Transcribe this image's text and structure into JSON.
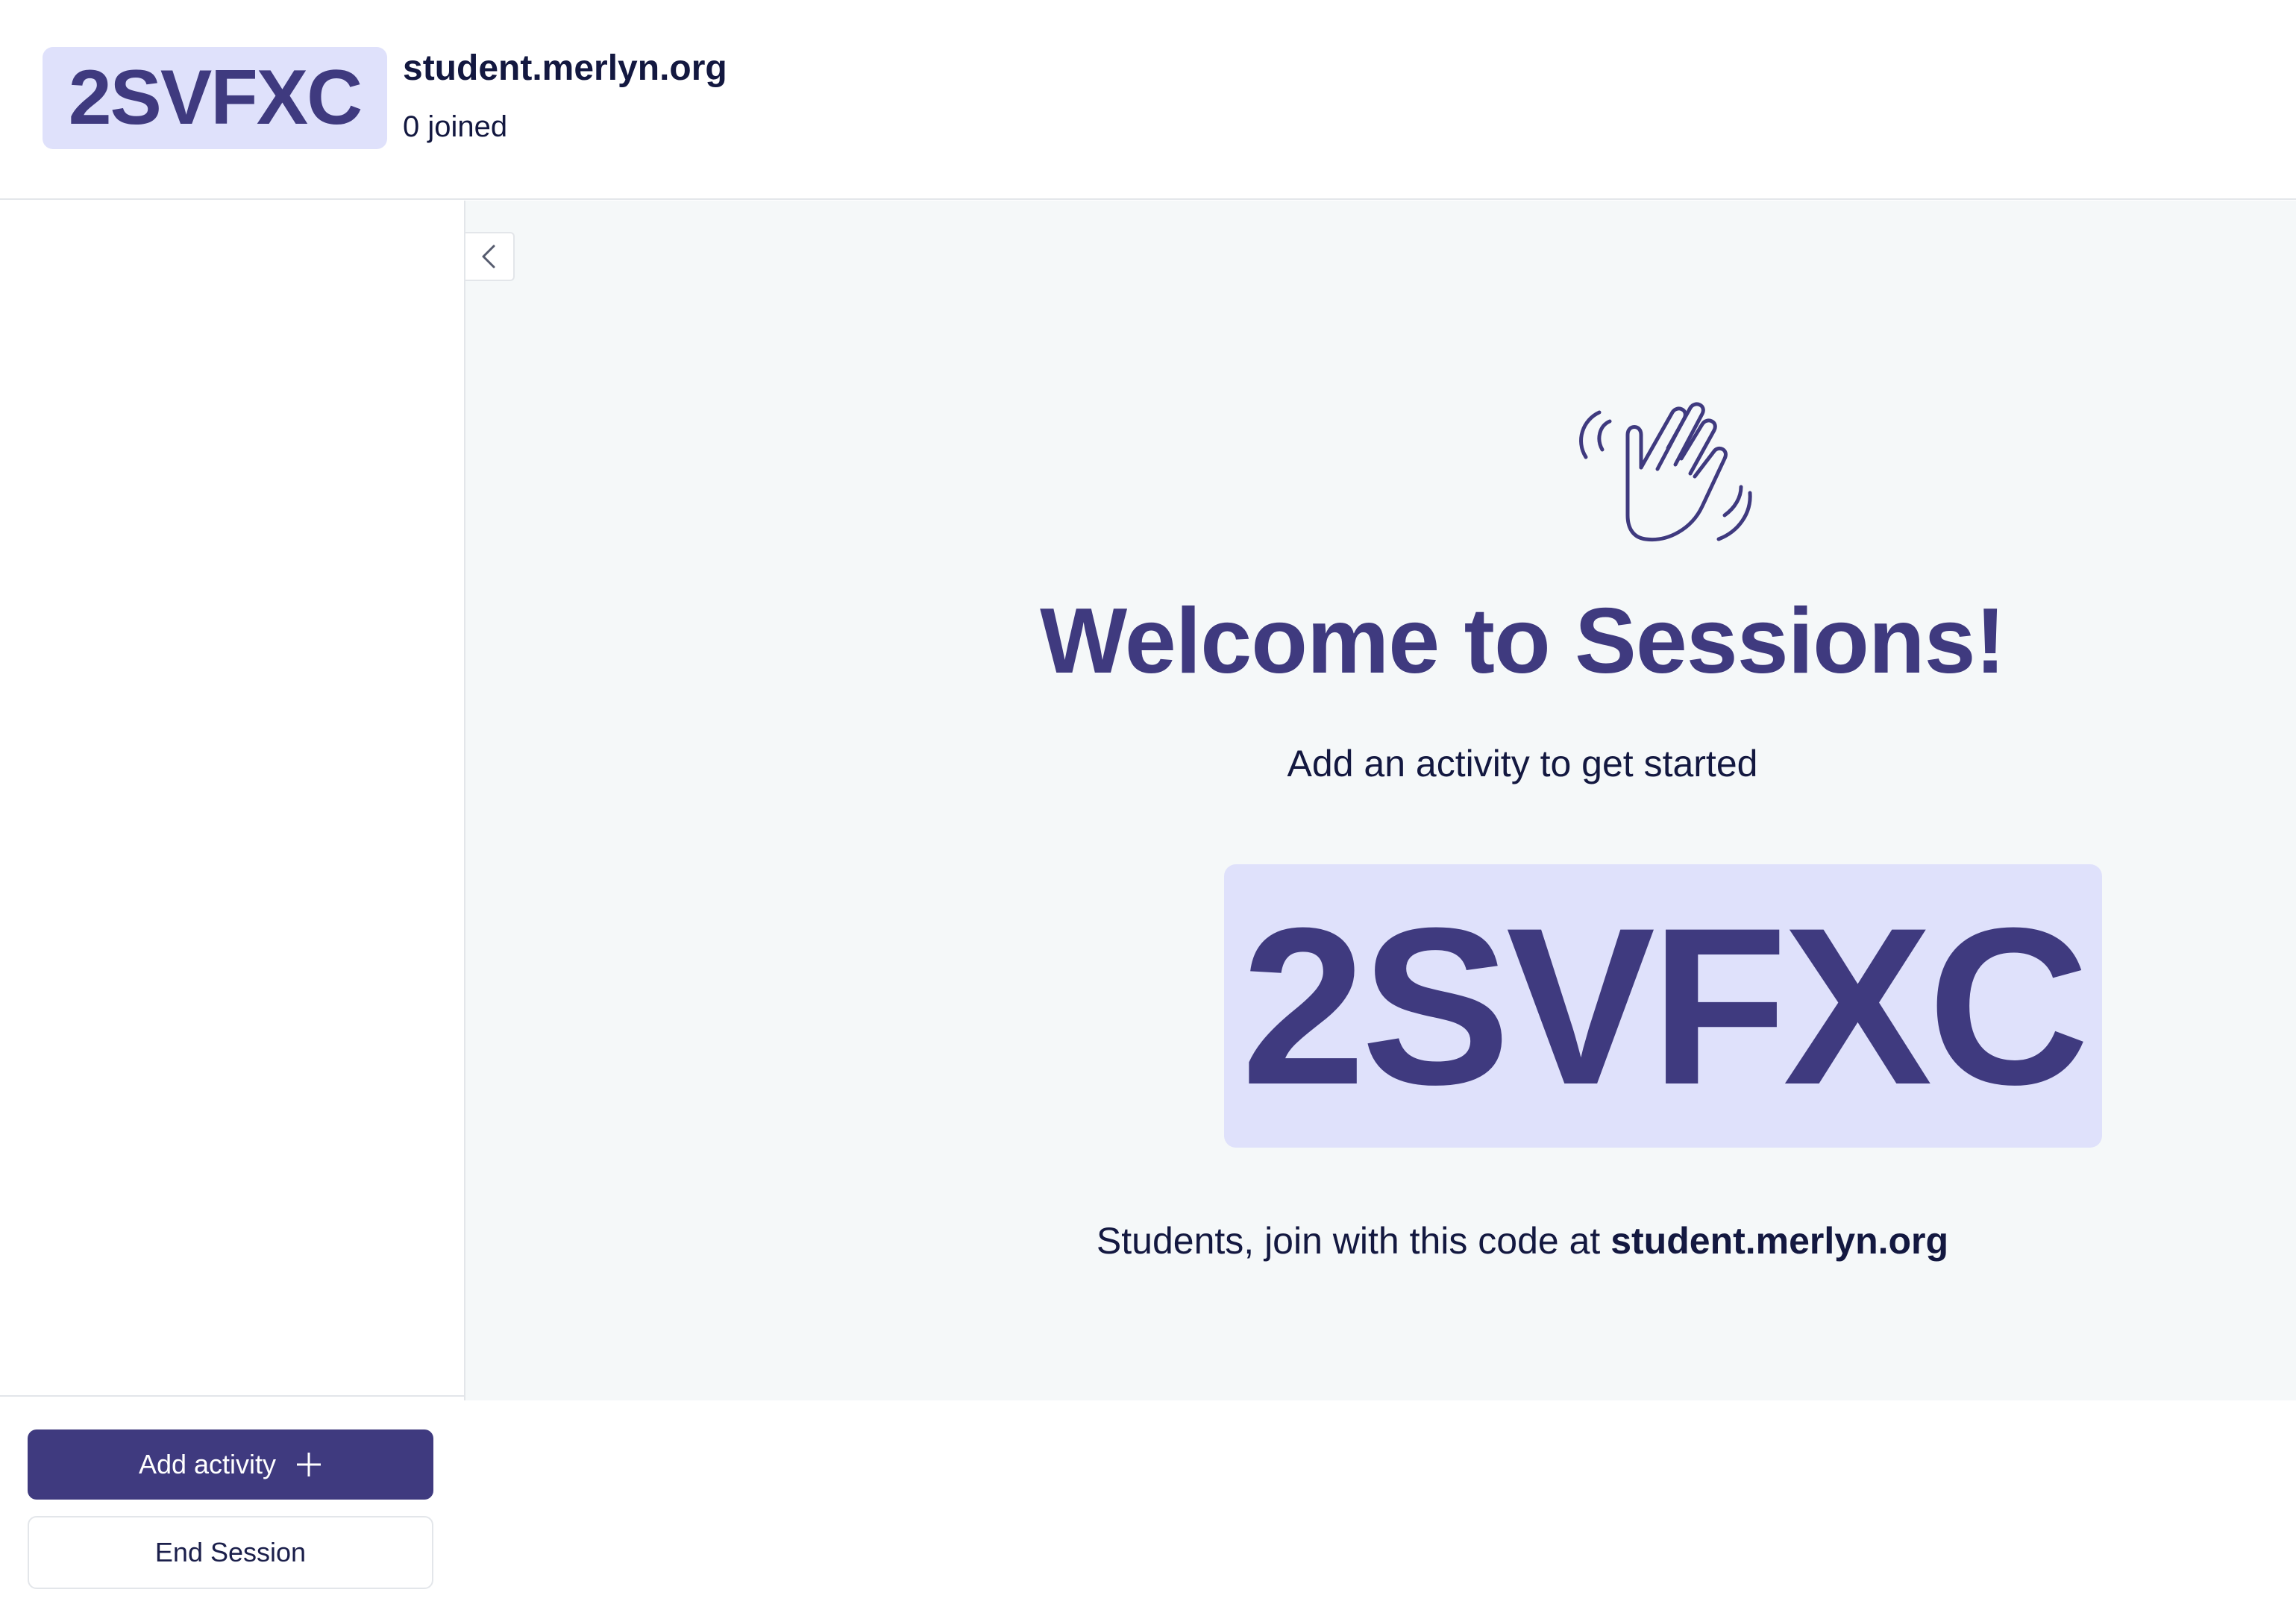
{
  "header": {
    "session_code": "2SVFXC",
    "site_url": "student.merlyn.org",
    "joined_text": "0 joined"
  },
  "sidebar": {
    "add_activity_label": "Add activity",
    "end_session_label": "End Session"
  },
  "main": {
    "icon": "waving-hand-icon",
    "welcome_title": "Welcome to Sessions!",
    "subtitle": "Add an activity to get started",
    "session_code": "2SVFXC",
    "join_prefix": "Students, join with this code at ",
    "join_url": "student.merlyn.org"
  },
  "colors": {
    "accent": "#3f3a7f",
    "chip_bg": "#dfe1fb",
    "main_bg": "#f5f8f9",
    "text": "#131840"
  }
}
